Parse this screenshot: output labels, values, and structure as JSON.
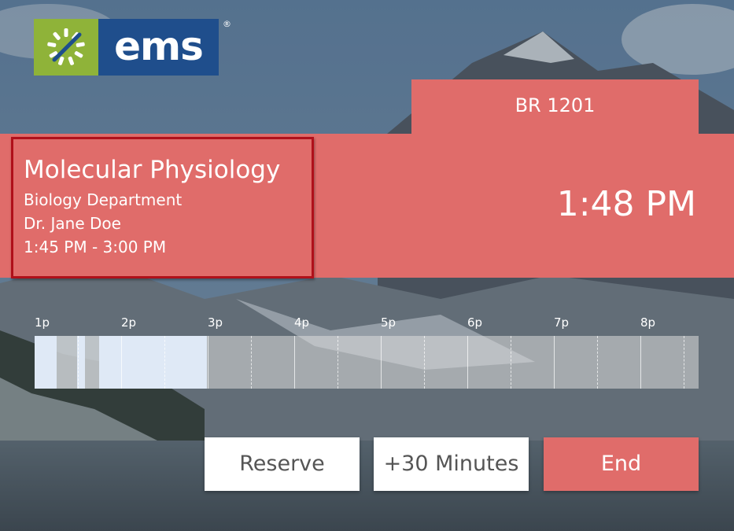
{
  "logo": {
    "text": "ems",
    "reg": "®",
    "icon": "sun-burst-icon"
  },
  "room": {
    "name": "BR 1201"
  },
  "event": {
    "title": "Molecular Physiology",
    "department": "Biology Department",
    "host": "Dr. Jane Doe",
    "time_range": "1:45 PM - 3:00 PM"
  },
  "clock": {
    "current_time": "1:48 PM"
  },
  "timeline": {
    "hour_labels": [
      "1p",
      "2p",
      "3p",
      "4p",
      "5p",
      "6p",
      "7p",
      "8p"
    ]
  },
  "actions": {
    "reserve_label": "Reserve",
    "extend_label": "+30 Minutes",
    "end_label": "End"
  },
  "colors": {
    "accent": "#e06c6a",
    "highlight_border": "#b0101a",
    "logo_green": "#8fb339",
    "logo_blue": "#1f4e8c",
    "booked_block": "#dfe9f6"
  }
}
